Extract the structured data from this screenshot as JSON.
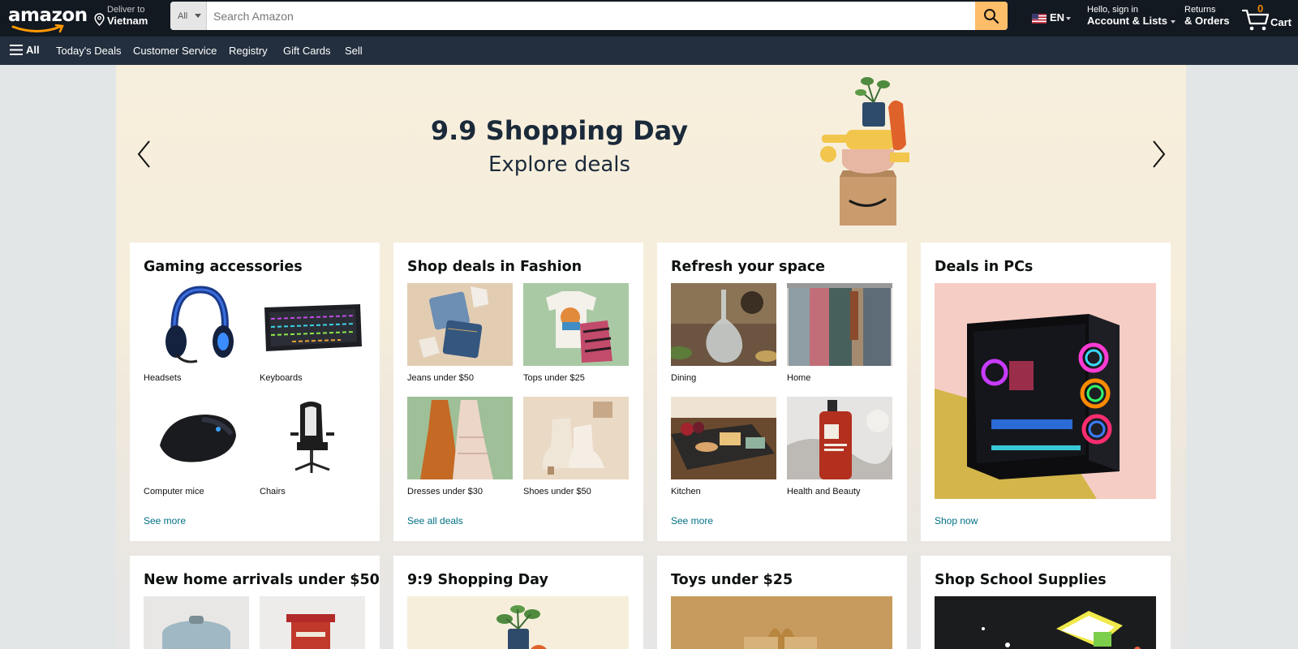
{
  "header": {
    "logo_text": "amazon",
    "deliver_line1": "Deliver to",
    "deliver_line2": "Vietnam",
    "search_category": "All",
    "search_placeholder": "Search Amazon",
    "language": "EN",
    "account_line1": "Hello, sign in",
    "account_line2": "Account & Lists",
    "returns_line1": "Returns",
    "returns_line2": "& Orders",
    "cart_count": "0",
    "cart_label": "Cart",
    "colors": {
      "nav": "#131921",
      "subnav": "#232f3e",
      "search_button": "#febd69",
      "cart_count": "#f08804"
    }
  },
  "subnav": {
    "all_label": "All",
    "links": [
      "Today's Deals",
      "Customer Service",
      "Registry",
      "Gift Cards",
      "Sell"
    ]
  },
  "hero": {
    "title": "9.9 Shopping Day",
    "subtitle": "Explore deals"
  },
  "cards": [
    {
      "title": "Gaming accessories",
      "items": [
        {
          "label": "Headsets",
          "icon": "headset-image"
        },
        {
          "label": "Keyboards",
          "icon": "keyboard-image"
        },
        {
          "label": "Computer mice",
          "icon": "mouse-image"
        },
        {
          "label": "Chairs",
          "icon": "chair-image"
        }
      ],
      "link": "See more"
    },
    {
      "title": "Shop deals in Fashion",
      "items": [
        {
          "label": "Jeans under $50",
          "icon": "jeans-image"
        },
        {
          "label": "Tops under $25",
          "icon": "tops-image"
        },
        {
          "label": "Dresses under $30",
          "icon": "dresses-image"
        },
        {
          "label": "Shoes under $50",
          "icon": "shoes-image"
        }
      ],
      "link": "See all deals"
    },
    {
      "title": "Refresh your space",
      "items": [
        {
          "label": "Dining",
          "icon": "dining-image"
        },
        {
          "label": "Home",
          "icon": "home-image"
        },
        {
          "label": "Kitchen",
          "icon": "kitchen-image"
        },
        {
          "label": "Health and Beauty",
          "icon": "beauty-image"
        }
      ],
      "link": "See more"
    },
    {
      "title": "Deals in PCs",
      "link": "Shop now"
    },
    {
      "title": "New home arrivals under $50"
    },
    {
      "title": "9:9 Shopping Day"
    },
    {
      "title": "Toys under $25"
    },
    {
      "title": "Shop School Supplies"
    }
  ]
}
